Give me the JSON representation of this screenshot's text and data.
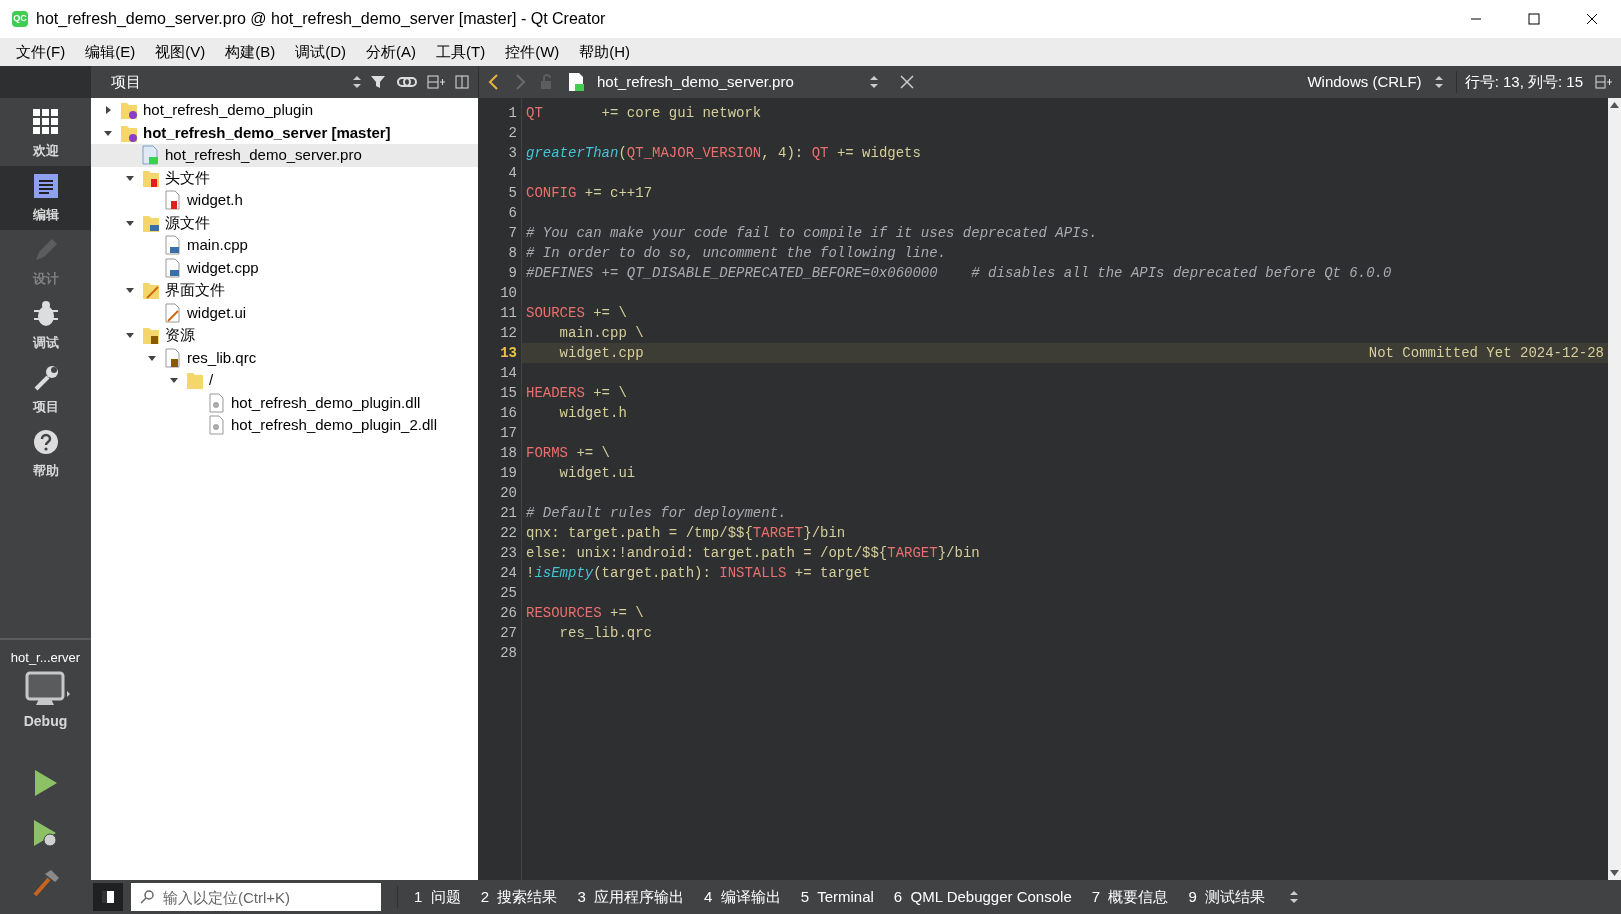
{
  "window": {
    "title": "hot_refresh_demo_server.pro @ hot_refresh_demo_server [master] - Qt Creator",
    "app_icon": "QC"
  },
  "menu": [
    "文件(F)",
    "编辑(E)",
    "视图(V)",
    "构建(B)",
    "调试(D)",
    "分析(A)",
    "工具(T)",
    "控件(W)",
    "帮助(H)"
  ],
  "modes": [
    {
      "label": "欢迎",
      "kind": "grid",
      "selected": false,
      "disabled": false
    },
    {
      "label": "编辑",
      "kind": "edit",
      "selected": true,
      "disabled": false
    },
    {
      "label": "设计",
      "kind": "pencil",
      "selected": false,
      "disabled": true
    },
    {
      "label": "调试",
      "kind": "bug",
      "selected": false,
      "disabled": false
    },
    {
      "label": "项目",
      "kind": "wrench",
      "selected": false,
      "disabled": false
    },
    {
      "label": "帮助",
      "kind": "help",
      "selected": false,
      "disabled": false
    }
  ],
  "kit": {
    "project": "hot_r...erver",
    "build": "Debug"
  },
  "project_panel": {
    "title": "项目",
    "tree": [
      {
        "label": "hot_refresh_demo_plugin",
        "kind": "project",
        "expanded": false,
        "bold": false,
        "selected": false
      },
      {
        "label": "hot_refresh_demo_server [master]",
        "kind": "project",
        "expanded": true,
        "bold": true,
        "selected": false,
        "children": [
          {
            "label": "hot_refresh_demo_server.pro",
            "kind": "pro",
            "selected": true,
            "bold": false
          },
          {
            "label": "头文件",
            "kind": "folder_h",
            "expanded": true,
            "bold": false,
            "selected": false,
            "children": [
              {
                "label": "widget.h",
                "kind": "h",
                "selected": false,
                "bold": false
              }
            ]
          },
          {
            "label": "源文件",
            "kind": "folder_cpp",
            "expanded": true,
            "bold": false,
            "selected": false,
            "children": [
              {
                "label": "main.cpp",
                "kind": "cpp",
                "selected": false,
                "bold": false
              },
              {
                "label": "widget.cpp",
                "kind": "cpp",
                "selected": false,
                "bold": false
              }
            ]
          },
          {
            "label": "界面文件",
            "kind": "folder_ui",
            "expanded": true,
            "bold": false,
            "selected": false,
            "children": [
              {
                "label": "widget.ui",
                "kind": "ui",
                "selected": false,
                "bold": false
              }
            ]
          },
          {
            "label": "资源",
            "kind": "folder_qrc",
            "expanded": true,
            "bold": false,
            "selected": false,
            "children": [
              {
                "label": "res_lib.qrc",
                "kind": "qrc",
                "expanded": true,
                "bold": false,
                "selected": false,
                "children": [
                  {
                    "label": "/",
                    "kind": "folder",
                    "expanded": true,
                    "bold": false,
                    "selected": false,
                    "children": [
                      {
                        "label": "hot_refresh_demo_plugin.dll",
                        "kind": "file",
                        "selected": false,
                        "bold": false
                      },
                      {
                        "label": "hot_refresh_demo_plugin_2.dll",
                        "kind": "file",
                        "selected": false,
                        "bold": false
                      }
                    ]
                  }
                ]
              }
            ]
          }
        ]
      }
    ]
  },
  "editor": {
    "file": "hot_refresh_demo_server.pro",
    "line_ending": "Windows (CRLF)",
    "position": "行号: 13, 列号: 15",
    "blame": "Not Committed Yet 2024-12-28",
    "lines": [
      {
        "number": "1",
        "current": false,
        "segments": [
          {
            "text": "QT",
            "kind": "key"
          },
          {
            "text": "       += core gui network",
            "kind": "plain"
          }
        ]
      },
      {
        "number": "2",
        "current": false
      },
      {
        "number": "3",
        "current": false,
        "segments": [
          {
            "text": "greaterThan",
            "kind": "func"
          },
          {
            "text": "(",
            "kind": "plain"
          },
          {
            "text": "QT_MAJOR_VERSION",
            "kind": "key"
          },
          {
            "text": ", 4): ",
            "kind": "plain"
          },
          {
            "text": "QT",
            "kind": "key"
          },
          {
            "text": " += widgets",
            "kind": "plain"
          }
        ]
      },
      {
        "number": "4",
        "current": false
      },
      {
        "number": "5",
        "current": false,
        "segments": [
          {
            "text": "CONFIG",
            "kind": "key"
          },
          {
            "text": " += c++17",
            "kind": "plain"
          }
        ]
      },
      {
        "number": "6",
        "current": false
      },
      {
        "number": "7",
        "current": false,
        "segments": [
          {
            "text": "# You can make your code fail to compile if it uses deprecated APIs.",
            "kind": "comment"
          }
        ]
      },
      {
        "number": "8",
        "current": false,
        "segments": [
          {
            "text": "# In order to do so, uncomment the following line.",
            "kind": "comment"
          }
        ]
      },
      {
        "number": "9",
        "current": false,
        "segments": [
          {
            "text": "#DEFINES += QT_DISABLE_DEPRECATED_BEFORE=0x060000    # disables all the APIs deprecated before Qt 6.0.0",
            "kind": "comment"
          }
        ]
      },
      {
        "number": "10",
        "current": false
      },
      {
        "number": "11",
        "current": false,
        "segments": [
          {
            "text": "SOURCES",
            "kind": "key"
          },
          {
            "text": " += \\",
            "kind": "plain"
          }
        ]
      },
      {
        "number": "12",
        "current": false,
        "segments": [
          {
            "text": "    main.cpp \\",
            "kind": "plain"
          }
        ]
      },
      {
        "number": "13",
        "current": true,
        "segments": [
          {
            "text": "    widget.cpp",
            "kind": "plain"
          }
        ]
      },
      {
        "number": "14",
        "current": false
      },
      {
        "number": "15",
        "current": false,
        "segments": [
          {
            "text": "HEADERS",
            "kind": "key"
          },
          {
            "text": " += \\",
            "kind": "plain"
          }
        ]
      },
      {
        "number": "16",
        "current": false,
        "segments": [
          {
            "text": "    widget.h",
            "kind": "plain"
          }
        ]
      },
      {
        "number": "17",
        "current": false
      },
      {
        "number": "18",
        "current": false,
        "segments": [
          {
            "text": "FORMS",
            "kind": "key"
          },
          {
            "text": " += \\",
            "kind": "plain"
          }
        ]
      },
      {
        "number": "19",
        "current": false,
        "segments": [
          {
            "text": "    widget.ui",
            "kind": "plain"
          }
        ]
      },
      {
        "number": "20",
        "current": false
      },
      {
        "number": "21",
        "current": false,
        "segments": [
          {
            "text": "# Default rules for deployment.",
            "kind": "comment"
          }
        ]
      },
      {
        "number": "22",
        "current": false,
        "segments": [
          {
            "text": "qnx: target.path = /tmp/$${",
            "kind": "plain"
          },
          {
            "text": "TARGET",
            "kind": "key"
          },
          {
            "text": "}/bin",
            "kind": "plain"
          }
        ]
      },
      {
        "number": "23",
        "current": false,
        "segments": [
          {
            "text": "else: unix:!android: target.path = /opt/$${",
            "kind": "plain"
          },
          {
            "text": "TARGET",
            "kind": "key"
          },
          {
            "text": "}/bin",
            "kind": "plain"
          }
        ]
      },
      {
        "number": "24",
        "current": false,
        "segments": [
          {
            "text": "!",
            "kind": "plain"
          },
          {
            "text": "isEmpty",
            "kind": "func"
          },
          {
            "text": "(target.path): ",
            "kind": "plain"
          },
          {
            "text": "INSTALLS",
            "kind": "key"
          },
          {
            "text": " += target",
            "kind": "plain"
          }
        ]
      },
      {
        "number": "25",
        "current": false
      },
      {
        "number": "26",
        "current": false,
        "segments": [
          {
            "text": "RESOURCES",
            "kind": "key"
          },
          {
            "text": " += \\",
            "kind": "plain"
          }
        ]
      },
      {
        "number": "27",
        "current": false,
        "segments": [
          {
            "text": "    res_lib.qrc",
            "kind": "plain"
          }
        ]
      },
      {
        "number": "28",
        "current": false
      }
    ]
  },
  "locator": {
    "placeholder": "输入以定位(Ctrl+K)"
  },
  "output_tabs": [
    {
      "number": "1",
      "label": "问题"
    },
    {
      "number": "2",
      "label": "搜索结果"
    },
    {
      "number": "3",
      "label": "应用程序输出"
    },
    {
      "number": "4",
      "label": "编译输出"
    },
    {
      "number": "5",
      "label": "Terminal"
    },
    {
      "number": "6",
      "label": "QML Debugger Console"
    },
    {
      "number": "7",
      "label": "概要信息"
    },
    {
      "number": "9",
      "label": "测试结果"
    }
  ]
}
